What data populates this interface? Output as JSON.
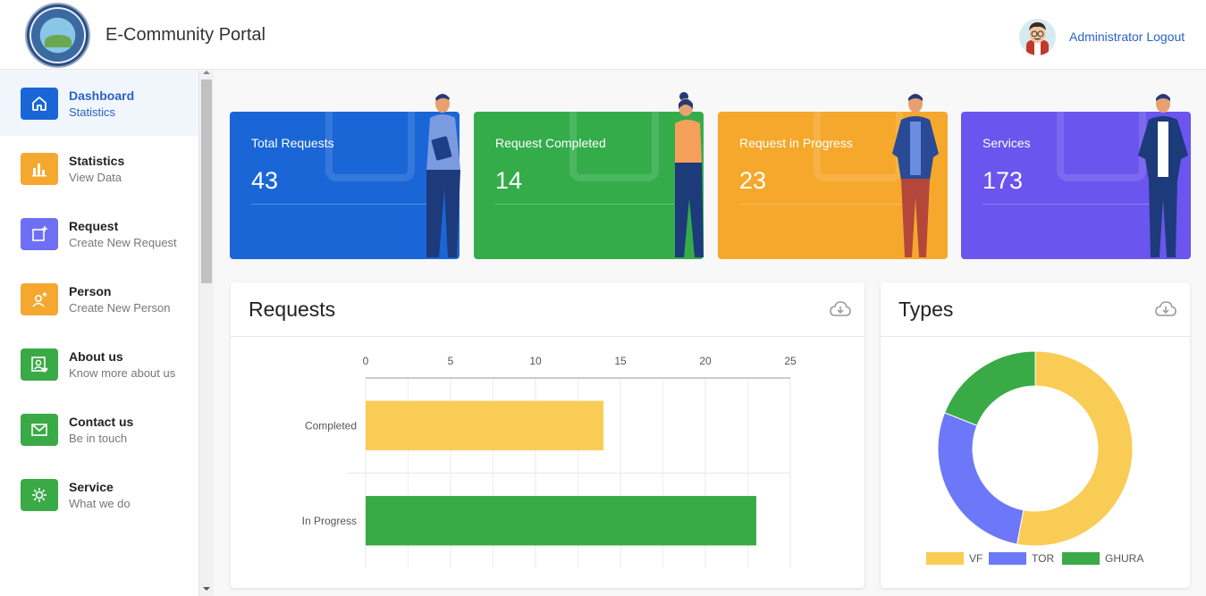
{
  "header": {
    "title": "E-Community Portal",
    "logout": "Administrator Logout"
  },
  "sidebar": {
    "items": [
      {
        "label": "Dashboard",
        "sub": "Statistics",
        "icon": "home-icon",
        "color": "#1a66d6",
        "active": true
      },
      {
        "label": "Statistics",
        "sub": "View Data",
        "icon": "bar-chart-icon",
        "color": "#f5a830"
      },
      {
        "label": "Request",
        "sub": "Create New Request",
        "icon": "add-request-icon",
        "color": "#6f6ff5"
      },
      {
        "label": "Person",
        "sub": "Create New Person",
        "icon": "add-person-icon",
        "color": "#f5a830"
      },
      {
        "label": "About us",
        "sub": "Know more about us",
        "icon": "profile-heart-icon",
        "color": "#3aaa47"
      },
      {
        "label": "Contact us",
        "sub": "Be in touch",
        "icon": "mail-icon",
        "color": "#3aaa47"
      },
      {
        "label": "Service",
        "sub": "What we do",
        "icon": "gear-icon",
        "color": "#3aaa47"
      }
    ]
  },
  "cards": [
    {
      "title": "Total Requests",
      "value": "43",
      "color": "#1a66d6",
      "icon": "upload-icon"
    },
    {
      "title": "Request Completed",
      "value": "14",
      "color": "#34ac4a",
      "icon": "check-icon"
    },
    {
      "title": "Request in Progress",
      "value": "23",
      "color": "#f5a82c",
      "icon": "clock-icon"
    },
    {
      "title": "Services",
      "value": "173",
      "color": "#6a55ee",
      "icon": "gear-icon"
    }
  ],
  "requests_panel": {
    "title": "Requests",
    "download_icon": "cloud-download-icon"
  },
  "types_panel": {
    "title": "Types",
    "download_icon": "cloud-download-icon"
  },
  "chart_data": [
    {
      "type": "bar",
      "orientation": "horizontal",
      "categories": [
        "Completed",
        "In Progress"
      ],
      "values": [
        14,
        23
      ],
      "colors": [
        "#f9cc55",
        "#3aaa47"
      ],
      "xlim": [
        0,
        25
      ],
      "xticks": [
        "0",
        "5",
        "10",
        "15",
        "20",
        "25"
      ],
      "x_axis_position": "top",
      "grid": true
    },
    {
      "type": "pie",
      "style": "donut",
      "labels": [
        "VF",
        "TOR",
        "GHURA"
      ],
      "values": [
        53,
        28,
        19
      ],
      "colors": [
        "#f9cc55",
        "#6d78f8",
        "#3aaa47"
      ],
      "legend": "bottom"
    }
  ]
}
